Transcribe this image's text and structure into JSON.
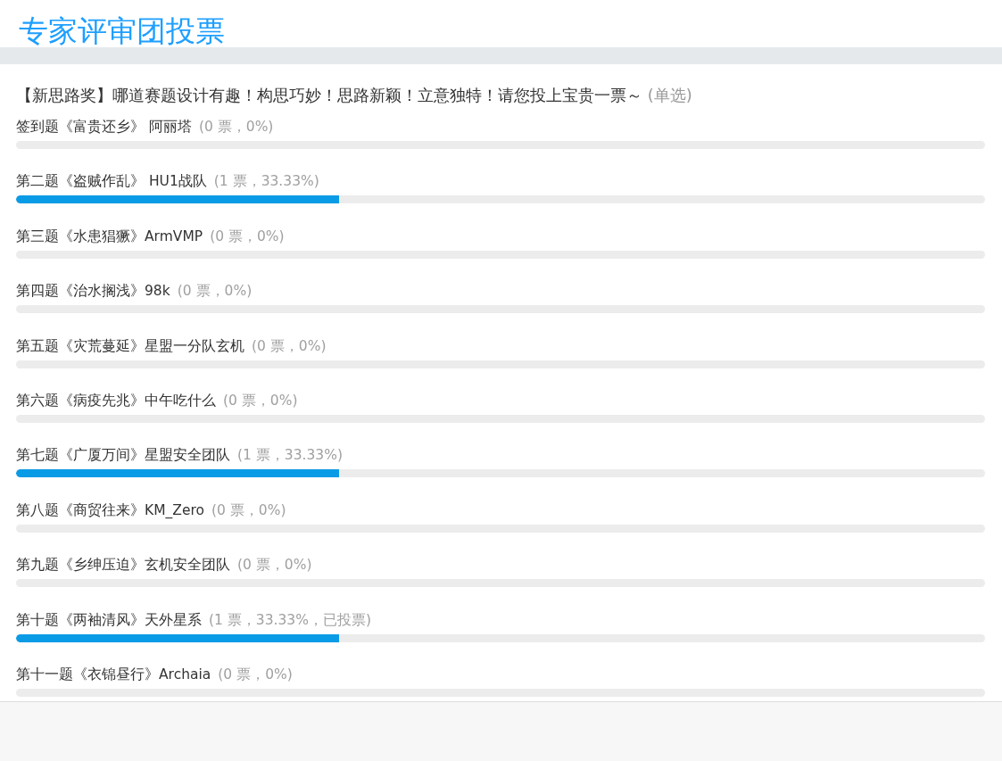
{
  "title": "专家评审团投票",
  "question": {
    "text": "【新思路奖】哪道赛题设计有趣！构思巧妙！思路新颖！立意独特！请您投上宝贵一票～",
    "mode": "(单选)"
  },
  "options": [
    {
      "label": "签到题《富贵还乡》 阿丽塔",
      "stats": "(0 票，0%)"
    },
    {
      "label": "第二题《盗贼作乱》 HU1战队",
      "stats": "(1 票，33.33%)",
      "level": 0.3333
    },
    {
      "label": "第三题《水患猖獗》ArmVMP",
      "stats": "(0 票，0%)"
    },
    {
      "label": "第四题《治水搁浅》98k",
      "stats": "(0 票，0%)"
    },
    {
      "label": "第五题《灾荒蔓延》星盟一分队玄机",
      "stats": "(0 票，0%)"
    },
    {
      "label": "第六题《病疫先兆》中午吃什么",
      "stats": "(0 票，0%)"
    },
    {
      "label": "第七题《广厦万间》星盟安全团队",
      "stats": "(1 票，33.33%)",
      "level": 0.3333
    },
    {
      "label": "第八题《商贸往来》KM_Zero",
      "stats": "(0 票，0%)"
    },
    {
      "label": "第九题《乡绅压迫》玄机安全团队",
      "stats": "(0 票，0%)"
    },
    {
      "label": "第十题《两袖清风》天外星系",
      "stats": "(1 票，33.33%，已投票)",
      "level": 0.3333
    },
    {
      "label": "第十一题《衣锦昼行》Archaia",
      "stats": "(0 票，0%)"
    }
  ]
}
